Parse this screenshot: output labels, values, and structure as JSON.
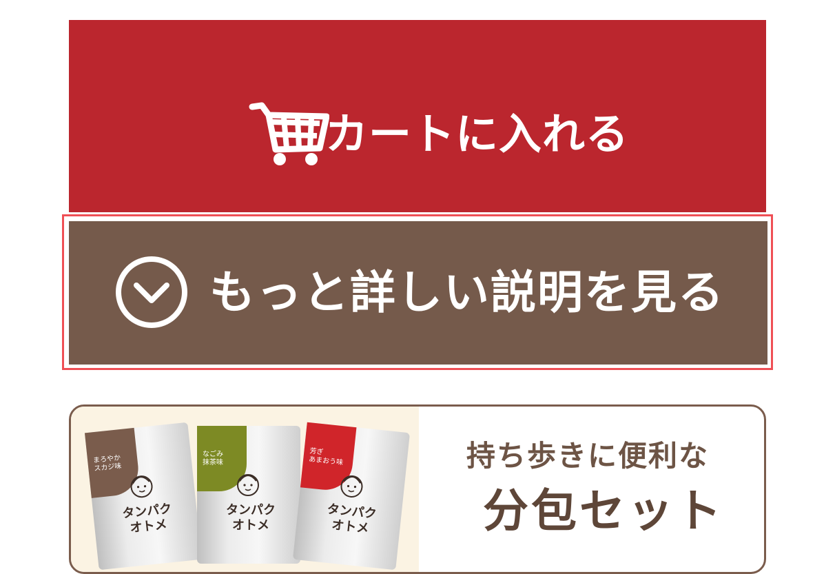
{
  "cart_button": {
    "label": "カートに入れる",
    "icon": "cart-icon",
    "color": "#bb262e"
  },
  "detail_button": {
    "label": "もっと詳しい説明を見る",
    "icon": "chevron-down-circle-icon",
    "color": "#755a4b",
    "focus_color": "#ef4f55"
  },
  "banner": {
    "line1": "持ち歩きに便利な",
    "line2": "分包セット",
    "packs": [
      {
        "tag": "まろやか\nスカジ味",
        "name": "タンパク\nオトメ",
        "tag_color": "#7a5c4c"
      },
      {
        "tag": "なごみ\n抹茶味",
        "name": "タンパク\nオトメ",
        "tag_color": "#7d8a24"
      },
      {
        "tag": "芳ぎ\nあまおう味",
        "name": "タンパク\nオトメ",
        "tag_color": "#d0252a"
      }
    ]
  }
}
